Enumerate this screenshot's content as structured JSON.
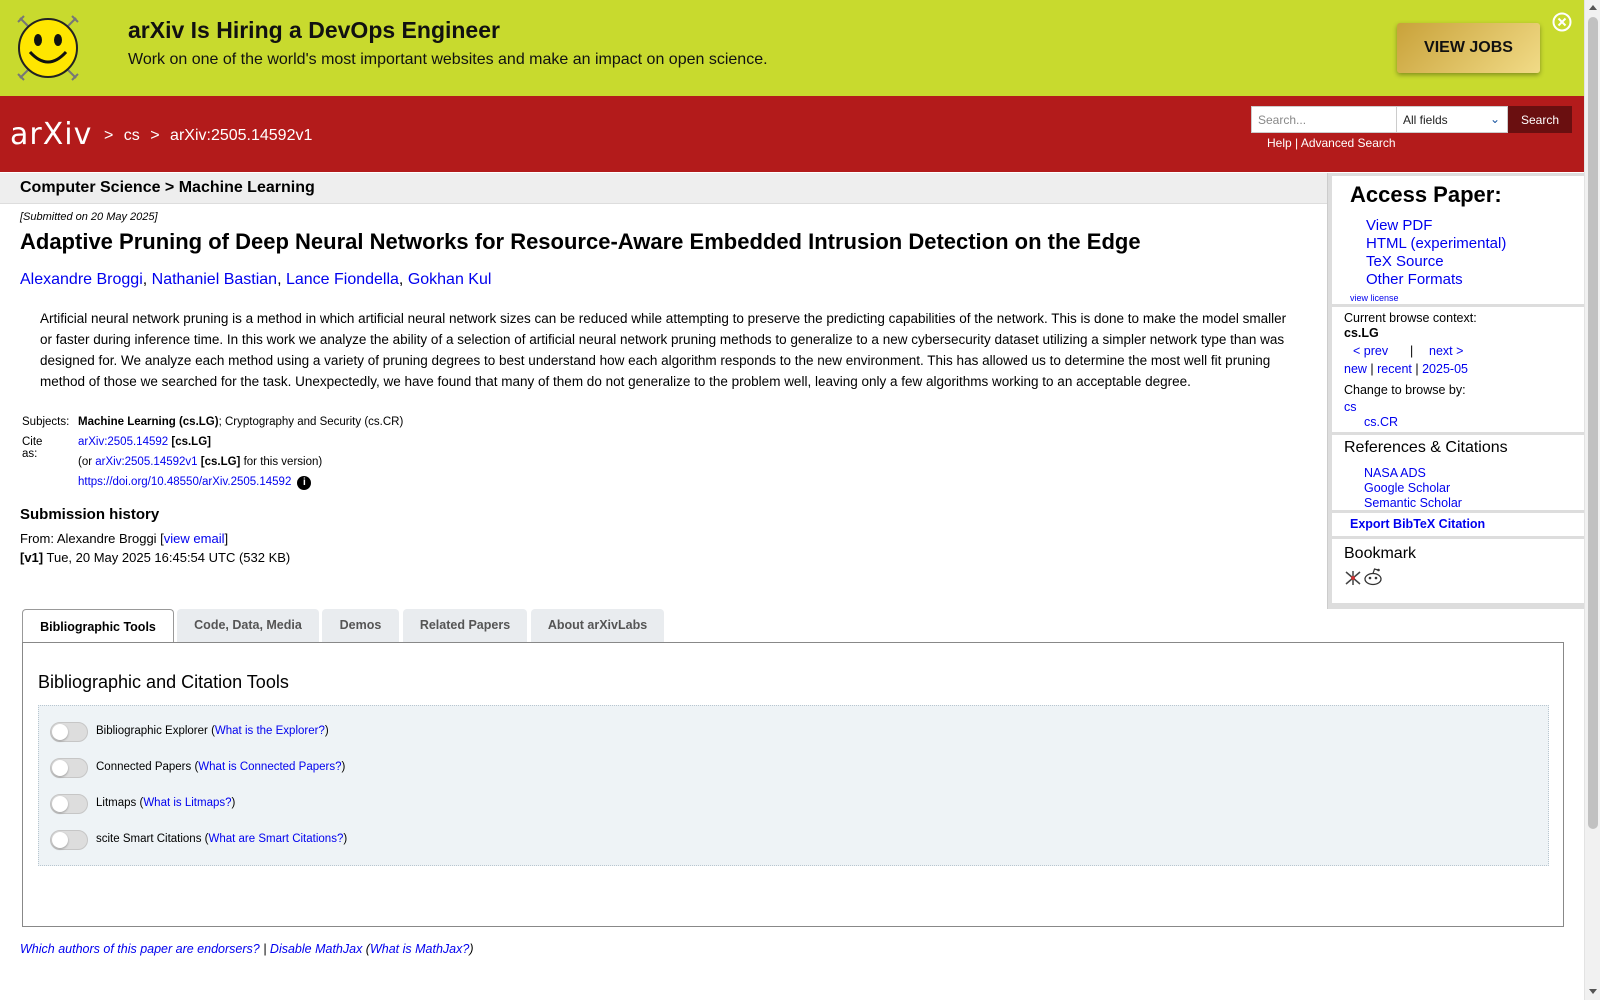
{
  "banner": {
    "title": "arXiv Is Hiring a DevOps Engineer",
    "text": "Work on one of the world's most important websites and make an impact on open science.",
    "button_label": "VIEW JOBS"
  },
  "header": {
    "logo_text": "arXiv",
    "breadcrumb": [
      ">",
      "cs",
      ">",
      "arXiv:2505.14592v1"
    ],
    "search_placeholder": "Search...",
    "search_field_selected": "All fields",
    "search_button": "Search",
    "help_label": "Help",
    "separator": "|",
    "advanced_label": "Advanced Search"
  },
  "page": {
    "category": "Computer Science > Machine Learning",
    "submitted": "[Submitted on 20 May 2025]",
    "title": "Adaptive Pruning of Deep Neural Networks for Resource-Aware Embedded Intrusion Detection on the Edge",
    "authors": [
      "Alexandre Broggi",
      "Nathaniel Bastian",
      "Lance Fiondella",
      "Gokhan Kul"
    ],
    "abstract": "Artificial neural network pruning is a method in which artificial neural network sizes can be reduced while attempting to preserve the predicting capabilities of the network. This is done to make the model smaller or faster during inference time. In this work we analyze the ability of a selection of artificial neural network pruning methods to generalize to a new cybersecurity dataset utilizing a simpler network type than was designed for. We analyze each method using a variety of pruning degrees to best understand how each algorithm responds to the new environment. This has allowed us to determine the most well fit pruning method of those we searched for the task. Unexpectedly, we have found that many of them do not generalize to the problem well, leaving only a few algorithms working to an acceptable degree."
  },
  "meta": {
    "subjects_label": "Subjects:",
    "subjects_primary": "Machine Learning (cs.LG)",
    "subjects_rest": "; Cryptography and Security (cs.CR)",
    "cite_label": "Cite as:",
    "cite_id": "arXiv:2505.14592",
    "cite_cat": "[cs.LG]",
    "version_prefix": "(or ",
    "version_id": "arXiv:2505.14592v1",
    "version_cat": "[cs.LG]",
    "version_suffix": " for this version)",
    "doi": "https://doi.org/10.48550/arXiv.2505.14592",
    "info_glyph": "i"
  },
  "history": {
    "title": "Submission history",
    "from_prefix": "From: Alexandre Broggi [",
    "view_email": "view email",
    "from_suffix": "]",
    "v1_tag": "[v1]",
    "v1_text": " Tue, 20 May 2025 16:45:54 UTC (532 KB)"
  },
  "sidebar": {
    "access_title": "Access Paper:",
    "access_links": [
      "View PDF",
      "HTML (experimental)",
      "TeX Source",
      "Other Formats"
    ],
    "license": "view license",
    "context_label": "Current browse context:",
    "context_value": "cs.LG",
    "prev": "< prev",
    "pipe": "|",
    "next": "next >",
    "new": "new",
    "recent": "recent",
    "month": "2025-05",
    "change_label": "Change to browse by:",
    "browse_cs": "cs",
    "browse_cr": "cs.CR",
    "refs_title": "References & Citations",
    "refs_links": [
      "NASA ADS",
      "Google Scholar",
      "Semantic Scholar"
    ],
    "bibtex": "Export BibTeX Citation",
    "bookmark_title": "Bookmark"
  },
  "tabs": [
    "Bibliographic Tools",
    "Code, Data, Media",
    "Demos",
    "Related Papers",
    "About arXivLabs"
  ],
  "tools": {
    "heading": "Bibliographic and Citation Tools",
    "items": [
      {
        "name": "Bibliographic Explorer",
        "help": "What is the Explorer?"
      },
      {
        "name": "Connected Papers",
        "help": "What is Connected Papers?"
      },
      {
        "name": "Litmaps",
        "help": "What is Litmaps?"
      },
      {
        "name": "scite Smart Citations",
        "help": "What are Smart Citations?"
      }
    ]
  },
  "footer": {
    "endorsers": "Which authors of this paper are endorsers?",
    "sep": " | ",
    "disable_mathjax": "Disable MathJax",
    "mathjax_help": "What is MathJax?"
  },
  "colors": {
    "banner_bg": "#c8da2e",
    "header_bg": "#b31b1b",
    "link": "#0000ee"
  }
}
